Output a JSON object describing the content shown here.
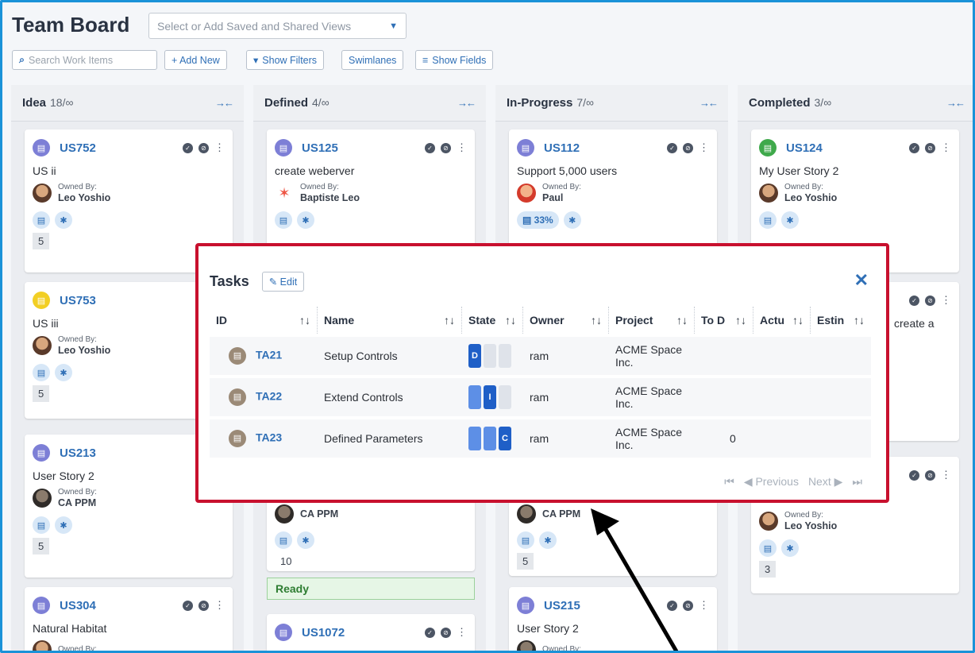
{
  "header": {
    "title": "Team Board",
    "views_placeholder": "Select or Add Saved and Shared Views",
    "search_placeholder": "Search Work Items",
    "add_new": "+ Add New",
    "show_filters": "Show Filters",
    "swimlanes": "Swimlanes",
    "show_fields": "Show Fields"
  },
  "columns": [
    {
      "name": "Idea",
      "count": "18/∞"
    },
    {
      "name": "Defined",
      "count": "4/∞"
    },
    {
      "name": "In-Progress",
      "count": "7/∞"
    },
    {
      "name": "Completed",
      "count": "3/∞"
    }
  ],
  "cards": {
    "us752": {
      "id": "US752",
      "desc": "US ii",
      "owner_label": "Owned By:",
      "owner": "Leo Yoshio",
      "points": "5"
    },
    "us753": {
      "id": "US753",
      "desc": "US iii",
      "owner_label": "Owned By:",
      "owner": "Leo Yoshio",
      "points": "5"
    },
    "us213": {
      "id": "US213",
      "desc": "User Story 2",
      "owner_label": "Owned By:",
      "owner": "CA PPM",
      "points": "5"
    },
    "us304": {
      "id": "US304",
      "desc": "Natural Habitat",
      "owner_label": "Owned By:"
    },
    "us125": {
      "id": "US125",
      "desc": "create weberver",
      "owner_label": "Owned By:",
      "owner": "Baptiste Leo"
    },
    "defined2": {
      "owner": "CA PPM",
      "points": "10"
    },
    "ready": "Ready",
    "us1072": {
      "id": "US1072"
    },
    "us112": {
      "id": "US112",
      "desc": "Support 5,000 users",
      "owner_label": "Owned By:",
      "owner": "Paul",
      "pct": "33%"
    },
    "inprog2": {
      "owner": "CA PPM",
      "points": "5"
    },
    "us215": {
      "id": "US215",
      "desc": "User Story 2",
      "owner_label": "Owned By:"
    },
    "us124": {
      "id": "US124",
      "desc": "My User Story 2",
      "owner_label": "Owned By:",
      "owner": "Leo Yoshio"
    },
    "comp2": {
      "desc_partial": "create a"
    },
    "comp3": {
      "owner_label": "Owned By:",
      "owner": "Leo Yoshio",
      "points": "3"
    }
  },
  "tasks_modal": {
    "title": "Tasks",
    "edit": "Edit",
    "columns": [
      "ID",
      "Name",
      "State",
      "Owner",
      "Project",
      "To Do",
      "Actual",
      "Estimate"
    ],
    "columns_display": [
      "ID",
      "Name",
      "State",
      "Owner",
      "Project",
      "To D",
      "Actu",
      "Estin"
    ],
    "rows": [
      {
        "id": "TA21",
        "name": "Setup Controls",
        "state_letter": "D",
        "owner": "ram",
        "project": "ACME Space Inc.",
        "todo": "",
        "actual": "",
        "estimate": ""
      },
      {
        "id": "TA22",
        "name": "Extend Controls",
        "state_letter": "I",
        "owner": "ram",
        "project": "ACME Space Inc.",
        "todo": "",
        "actual": "",
        "estimate": ""
      },
      {
        "id": "TA23",
        "name": "Defined Parameters",
        "state_letter": "C",
        "owner": "ram",
        "project": "ACME Space Inc.",
        "todo": "0",
        "actual": "",
        "estimate": ""
      }
    ],
    "pager": {
      "previous": "Previous",
      "next": "Next"
    }
  },
  "colors": {
    "accent": "#2f6fb6",
    "modal_border": "#c8102e",
    "frame": "#1a92d8"
  }
}
